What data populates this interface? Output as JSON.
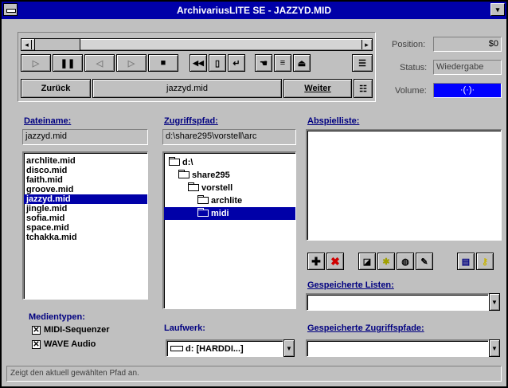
{
  "window": {
    "title": "ArchivariusLITE SE - JAZZYD.MID",
    "minimize_glyph": "▾"
  },
  "player": {
    "position_label": "Position:",
    "position_value": "$0",
    "status_label": "Status:",
    "status_value": "Wiedergabe",
    "volume_label": "Volume:",
    "volume_value": "·(·)·",
    "back_label": "Zurück",
    "track_name": "jazzyd.mid",
    "next_label": "Weiter",
    "transport_icons": [
      "play-icon",
      "pause-icon",
      "rewind-icon",
      "step-icon",
      "stop-icon",
      "skip-start-icon",
      "document-icon",
      "return-icon",
      "hand-icon",
      "list-edit-icon",
      "eject-icon",
      "waveform-icon"
    ],
    "extra_icon": "options-icon"
  },
  "files": {
    "label": "Dateiname:",
    "current": "jazzyd.mid",
    "items": [
      "archlite.mid",
      "disco.mid",
      "faith.mid",
      "groove.mid",
      "jazzyd.mid",
      "jingle.mid",
      "sofia.mid",
      "space.mid",
      "tchakka.mid"
    ],
    "selected_index": 4
  },
  "path": {
    "label": "Zugriffspfad:",
    "value": "d:\\share295\\vorstell\\arc",
    "tree": [
      {
        "label": "d:\\",
        "level": 0
      },
      {
        "label": "share295",
        "level": 1
      },
      {
        "label": "vorstell",
        "level": 2
      },
      {
        "label": "archlite",
        "level": 3
      },
      {
        "label": "midi",
        "level": 3
      }
    ],
    "selected_index": 4
  },
  "drive": {
    "label": "Laufwerk:",
    "value": "d: [HARDDI...]"
  },
  "playlist": {
    "label": "Abspielliste:",
    "buttons": [
      "add-icon",
      "remove-icon",
      "open-icon",
      "new-list-icon",
      "save-list-icon",
      "edit-list-icon",
      "print-icon",
      "key-icon"
    ]
  },
  "saved_lists": {
    "label": "Gespeicherte Listen:",
    "value": ""
  },
  "saved_paths": {
    "label": "Gespeicherte Zugriffspfade:",
    "value": ""
  },
  "media": {
    "label": "Medientypen:",
    "options": [
      {
        "label": "MIDI-Sequenzer",
        "checked": true
      },
      {
        "label": "WAVE Audio",
        "checked": true
      }
    ]
  },
  "status": {
    "text": "Zeigt den aktuell gewählten Pfad an."
  },
  "colors": {
    "title_bar": "#0000a8",
    "selection": "#0000a8",
    "volume_bg": "#0000ff",
    "label_blue": "#000080"
  }
}
